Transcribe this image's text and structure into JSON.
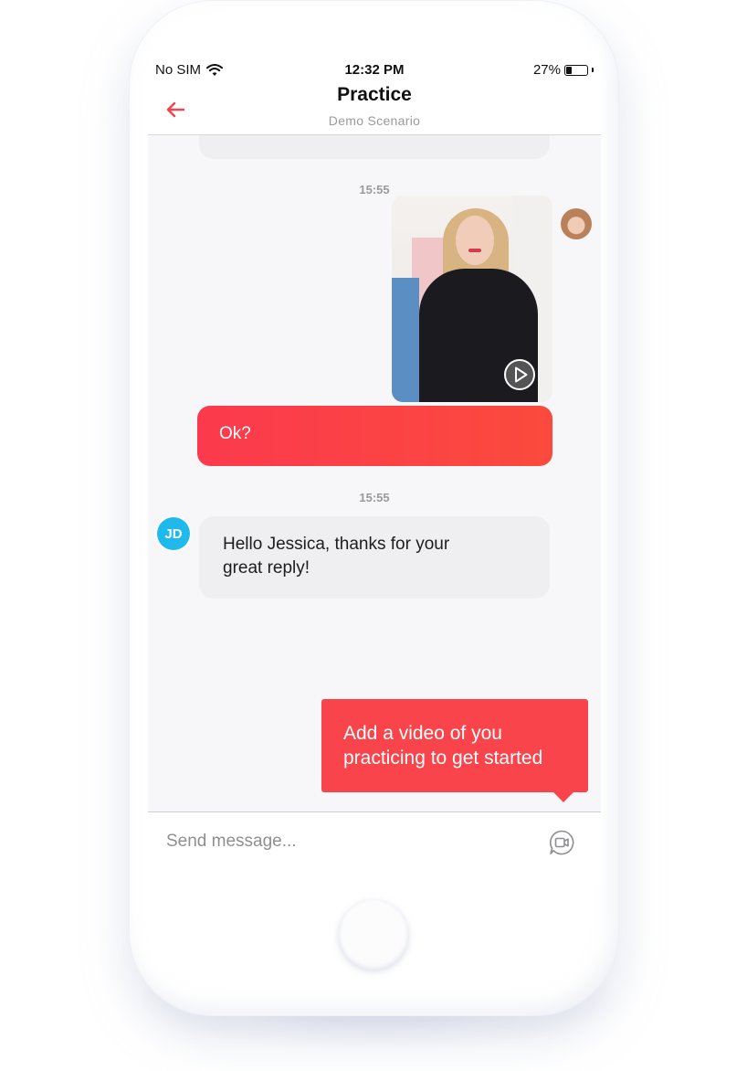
{
  "status_bar": {
    "carrier": "No SIM",
    "time": "12:32 PM",
    "battery": "27%",
    "battery_level": 0.27
  },
  "header": {
    "title": "Practice",
    "subtitle": "Demo Scenario",
    "back_icon": "arrow-left-icon"
  },
  "chat": {
    "messages": [
      {
        "timestamp": "15:55",
        "type": "video",
        "icon": "play-icon"
      },
      {
        "type": "text",
        "text": "Ok?",
        "direction": "sent"
      },
      {
        "timestamp": "15:55",
        "avatar_initials": "JD",
        "type": "text",
        "text_lines": [
          "Hello Jessica, thanks for your",
          "great reply!"
        ],
        "direction": "received"
      }
    ]
  },
  "tooltip": {
    "lines": [
      "Add a video of you",
      "practicing to get started"
    ]
  },
  "composer": {
    "placeholder": "Send message...",
    "icon": "video-camera-icon"
  },
  "colors": {
    "accent": "#fb3e4a",
    "avatar_jd": "#20b9ec"
  }
}
